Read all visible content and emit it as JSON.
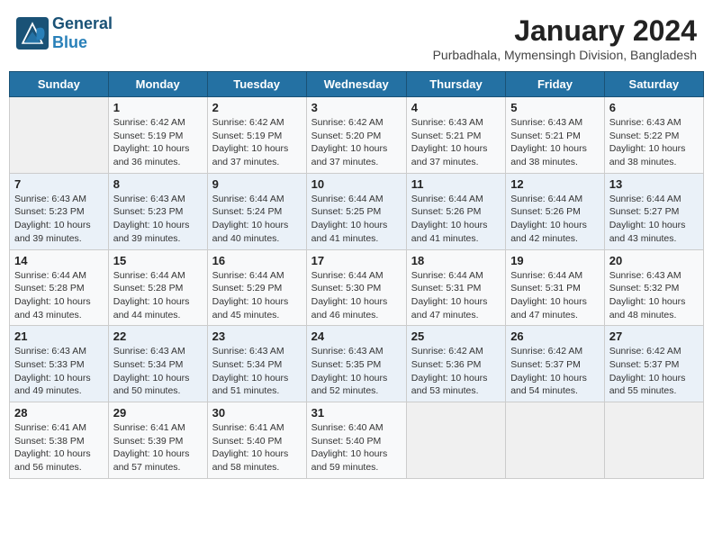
{
  "header": {
    "logo_general": "General",
    "logo_blue": "Blue",
    "month_year": "January 2024",
    "location": "Purbadhala, Mymensingh Division, Bangladesh"
  },
  "days_of_week": [
    "Sunday",
    "Monday",
    "Tuesday",
    "Wednesday",
    "Thursday",
    "Friday",
    "Saturday"
  ],
  "weeks": [
    [
      {
        "day": "",
        "info": ""
      },
      {
        "day": "1",
        "info": "Sunrise: 6:42 AM\nSunset: 5:19 PM\nDaylight: 10 hours and 36 minutes."
      },
      {
        "day": "2",
        "info": "Sunrise: 6:42 AM\nSunset: 5:19 PM\nDaylight: 10 hours and 37 minutes."
      },
      {
        "day": "3",
        "info": "Sunrise: 6:42 AM\nSunset: 5:20 PM\nDaylight: 10 hours and 37 minutes."
      },
      {
        "day": "4",
        "info": "Sunrise: 6:43 AM\nSunset: 5:21 PM\nDaylight: 10 hours and 37 minutes."
      },
      {
        "day": "5",
        "info": "Sunrise: 6:43 AM\nSunset: 5:21 PM\nDaylight: 10 hours and 38 minutes."
      },
      {
        "day": "6",
        "info": "Sunrise: 6:43 AM\nSunset: 5:22 PM\nDaylight: 10 hours and 38 minutes."
      }
    ],
    [
      {
        "day": "7",
        "info": "Sunrise: 6:43 AM\nSunset: 5:23 PM\nDaylight: 10 hours and 39 minutes."
      },
      {
        "day": "8",
        "info": "Sunrise: 6:43 AM\nSunset: 5:23 PM\nDaylight: 10 hours and 39 minutes."
      },
      {
        "day": "9",
        "info": "Sunrise: 6:44 AM\nSunset: 5:24 PM\nDaylight: 10 hours and 40 minutes."
      },
      {
        "day": "10",
        "info": "Sunrise: 6:44 AM\nSunset: 5:25 PM\nDaylight: 10 hours and 41 minutes."
      },
      {
        "day": "11",
        "info": "Sunrise: 6:44 AM\nSunset: 5:26 PM\nDaylight: 10 hours and 41 minutes."
      },
      {
        "day": "12",
        "info": "Sunrise: 6:44 AM\nSunset: 5:26 PM\nDaylight: 10 hours and 42 minutes."
      },
      {
        "day": "13",
        "info": "Sunrise: 6:44 AM\nSunset: 5:27 PM\nDaylight: 10 hours and 43 minutes."
      }
    ],
    [
      {
        "day": "14",
        "info": "Sunrise: 6:44 AM\nSunset: 5:28 PM\nDaylight: 10 hours and 43 minutes."
      },
      {
        "day": "15",
        "info": "Sunrise: 6:44 AM\nSunset: 5:28 PM\nDaylight: 10 hours and 44 minutes."
      },
      {
        "day": "16",
        "info": "Sunrise: 6:44 AM\nSunset: 5:29 PM\nDaylight: 10 hours and 45 minutes."
      },
      {
        "day": "17",
        "info": "Sunrise: 6:44 AM\nSunset: 5:30 PM\nDaylight: 10 hours and 46 minutes."
      },
      {
        "day": "18",
        "info": "Sunrise: 6:44 AM\nSunset: 5:31 PM\nDaylight: 10 hours and 47 minutes."
      },
      {
        "day": "19",
        "info": "Sunrise: 6:44 AM\nSunset: 5:31 PM\nDaylight: 10 hours and 47 minutes."
      },
      {
        "day": "20",
        "info": "Sunrise: 6:43 AM\nSunset: 5:32 PM\nDaylight: 10 hours and 48 minutes."
      }
    ],
    [
      {
        "day": "21",
        "info": "Sunrise: 6:43 AM\nSunset: 5:33 PM\nDaylight: 10 hours and 49 minutes."
      },
      {
        "day": "22",
        "info": "Sunrise: 6:43 AM\nSunset: 5:34 PM\nDaylight: 10 hours and 50 minutes."
      },
      {
        "day": "23",
        "info": "Sunrise: 6:43 AM\nSunset: 5:34 PM\nDaylight: 10 hours and 51 minutes."
      },
      {
        "day": "24",
        "info": "Sunrise: 6:43 AM\nSunset: 5:35 PM\nDaylight: 10 hours and 52 minutes."
      },
      {
        "day": "25",
        "info": "Sunrise: 6:42 AM\nSunset: 5:36 PM\nDaylight: 10 hours and 53 minutes."
      },
      {
        "day": "26",
        "info": "Sunrise: 6:42 AM\nSunset: 5:37 PM\nDaylight: 10 hours and 54 minutes."
      },
      {
        "day": "27",
        "info": "Sunrise: 6:42 AM\nSunset: 5:37 PM\nDaylight: 10 hours and 55 minutes."
      }
    ],
    [
      {
        "day": "28",
        "info": "Sunrise: 6:41 AM\nSunset: 5:38 PM\nDaylight: 10 hours and 56 minutes."
      },
      {
        "day": "29",
        "info": "Sunrise: 6:41 AM\nSunset: 5:39 PM\nDaylight: 10 hours and 57 minutes."
      },
      {
        "day": "30",
        "info": "Sunrise: 6:41 AM\nSunset: 5:40 PM\nDaylight: 10 hours and 58 minutes."
      },
      {
        "day": "31",
        "info": "Sunrise: 6:40 AM\nSunset: 5:40 PM\nDaylight: 10 hours and 59 minutes."
      },
      {
        "day": "",
        "info": ""
      },
      {
        "day": "",
        "info": ""
      },
      {
        "day": "",
        "info": ""
      }
    ]
  ]
}
